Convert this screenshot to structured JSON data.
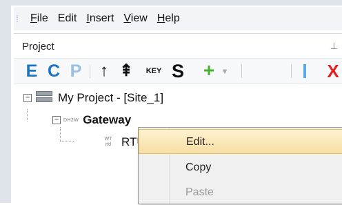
{
  "menubar": {
    "items": [
      {
        "label": "File",
        "mnemonic": "F",
        "rest": "ile"
      },
      {
        "label": "Edit",
        "mnemonic": "",
        "rest": "Edit"
      },
      {
        "label": "Insert",
        "mnemonic": "I",
        "rest": "nsert"
      },
      {
        "label": "View",
        "mnemonic": "V",
        "rest": "iew"
      },
      {
        "label": "Help",
        "mnemonic": "H",
        "rest": "elp"
      }
    ]
  },
  "panel": {
    "title": "Project",
    "pin_icon": "pin-icon"
  },
  "toolbar": {
    "e_label": "E",
    "c_label": "C",
    "p_label": "P",
    "up_arrow": "↑",
    "double_up": "⇞",
    "key_label": "KEY",
    "s_label": "S",
    "plus_label": "+",
    "dropdown_arrow": "▾",
    "x_label": "X",
    "colors": {
      "blue": "#1b73c8",
      "light_blue": "#98c0e6",
      "green": "#45b12f",
      "red": "#e02424"
    }
  },
  "tree": {
    "project": {
      "expander": "−",
      "label": "My Project - [Site_1]"
    },
    "gateway": {
      "expander": "−",
      "prefix": "DH2W",
      "label": "Gateway"
    },
    "rtu": {
      "icon_top": "WT",
      "icon_bottom": "rtd",
      "label": "RTU"
    }
  },
  "context_menu": {
    "items": [
      {
        "label": "Edit...",
        "state": "hover"
      },
      {
        "label": "Copy",
        "state": "normal"
      },
      {
        "label": "Paste",
        "state": "disabled"
      }
    ],
    "hover_color": "#f7dea3"
  }
}
